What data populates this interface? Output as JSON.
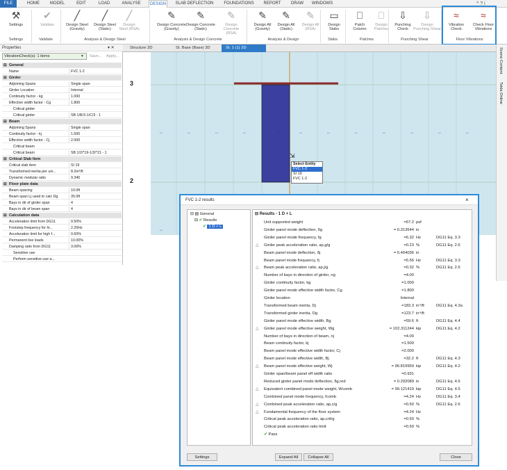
{
  "tabs": [
    "FILE",
    "HOME",
    "MODEL",
    "EDIT",
    "LOAD",
    "ANALYSE",
    "DESIGN",
    "SLAB DEFLECTION",
    "FOUNDATIONS",
    "REPORT",
    "DRAW",
    "WINDOWS"
  ],
  "window_icons": [
    "^",
    "?",
    "i"
  ],
  "ribbon": {
    "buttons": [
      "Settings",
      "Validate",
      "Design Steel (Gravity)",
      "Design Steel (Static)",
      "Design Steel (RSA)",
      "Design Concrete (Gravity)",
      "Design Concrete (Static)",
      "Design Concrete (RSA)",
      "Design All (Gravity)",
      "Design All (Static)",
      "Design All (RSA)",
      "Design Slabs",
      "Patch Column",
      "Design Patches",
      "Punching Check",
      "Design Punching Shear",
      "Vibration Check",
      "Check Floor Vibrations"
    ],
    "groups": [
      "Settings",
      "Validate",
      "Analysis & Design Steel",
      "Analysis & Design Concrete",
      "Analysis & Design",
      "Slabs",
      "Patches",
      "Punching Shear",
      "Floor Vibrations"
    ]
  },
  "properties": {
    "title": "Properties",
    "filter": "VibrationCheck(s): 1 items",
    "save": "Save...",
    "apply": "Apply...",
    "rows": [
      {
        "k": "General",
        "v": "",
        "h": true
      },
      {
        "k": "Name",
        "v": "FVC 1-2"
      },
      {
        "k": "Girder",
        "v": "",
        "h": true
      },
      {
        "k": "Adjoining Spans",
        "v": "Single span"
      },
      {
        "k": "Girder Location",
        "v": "Internal"
      },
      {
        "k": "Continuity factor - kg",
        "v": "1.000"
      },
      {
        "k": "Effective width factor - Cg",
        "v": "1.800"
      },
      {
        "k": "Critical girder",
        "v": "",
        "s": true
      },
      {
        "k": "Critical girder",
        "v": "SB 1/B/3-1/C/3 - 1",
        "s": true
      },
      {
        "k": "Beam",
        "v": "",
        "h": true
      },
      {
        "k": "Adjoining Spans",
        "v": "Single span"
      },
      {
        "k": "Continuity factor - kj",
        "v": "1.500"
      },
      {
        "k": "Effective width factor - Cj",
        "v": "2.000"
      },
      {
        "k": "Critical beam",
        "v": "",
        "s": true
      },
      {
        "k": "Critical beam",
        "v": "SB 1/2/*19-1/3/*21 - 1",
        "s": true
      },
      {
        "k": "Critical Slab Item",
        "v": "",
        "h": true
      },
      {
        "k": "Critical slab item",
        "v": "SI 19"
      },
      {
        "k": "Transformed inertia per uni...",
        "v": "8.2in³/ft"
      },
      {
        "k": "Dynamic modular ratio",
        "v": "9.340"
      },
      {
        "k": "Floor plate data",
        "v": "",
        "h": true
      },
      {
        "k": "Beam spacing",
        "v": "10.0ft"
      },
      {
        "k": "Beam span Lj used to calc Dg",
        "v": "35.0ft"
      },
      {
        "k": "Bays in dir of girder span",
        "v": "4"
      },
      {
        "k": "Bays in dir of beam span",
        "v": "4"
      },
      {
        "k": "Calculation data",
        "v": "",
        "h": true
      },
      {
        "k": "Acceleration limit from DG11",
        "v": "0.50%"
      },
      {
        "k": "Footstep frequency for hi...",
        "v": "2.20Hz"
      },
      {
        "k": "Acceleration limit for high f...",
        "v": "0.60%"
      },
      {
        "k": "Permanent live loads",
        "v": "10.00%"
      },
      {
        "k": "Damping ratio from DG11",
        "v": "3.00%"
      },
      {
        "k": "Sensitive use",
        "v": "",
        "s": true
      },
      {
        "k": "Perform sensitive use a...",
        "v": "",
        "s": true
      }
    ]
  },
  "view_tabs": [
    "Structure 3D",
    "St. Base (Base) 3D",
    "St. 1 (1) 2D"
  ],
  "side_tabs": [
    "Scene Content",
    "Tekla Online"
  ],
  "canvas": {
    "grid_labels": [
      "3",
      "2"
    ],
    "select_entity": {
      "title": "Select Entity",
      "items": [
        "FVC 1-2",
        "SI 19",
        "FVC 1-2"
      ]
    }
  },
  "dialog": {
    "title": "FVC 1-2 results",
    "close": "×",
    "tree": [
      "General",
      "Results",
      "1 D + L"
    ],
    "header": "Results - 1 D + L",
    "rows": [
      {
        "l": "Unit supported weight",
        "v": "=57.2",
        "u": "psf",
        "r": ""
      },
      {
        "l": "Girder panel mode deflection, δg",
        "v": "= 0.313644",
        "u": "in",
        "r": ""
      },
      {
        "l": "Girder panel mode frequency, fg",
        "v": "=6.32",
        "u": "Hz",
        "r": "DG11 Eq. 3.3"
      },
      {
        "l": "Girder peak acceleration ratio, ap,g/g",
        "v": "=0.23",
        "u": "%",
        "r": "DG11 Eq. 2.6",
        "w": true
      },
      {
        "l": "Beam panel mode deflection, δj",
        "v": "= 0.404036",
        "u": "in",
        "r": ""
      },
      {
        "l": "Beam panel mode frequency, fj",
        "v": "=5.56",
        "u": "Hz",
        "r": "DG11 Eq. 3.3"
      },
      {
        "l": "Beam peak acceleration ratio, ap,j/g",
        "v": "=0.32",
        "u": "%",
        "r": "DG11 Eq. 2.6",
        "w": true
      },
      {
        "l": "Number of bays in direction of girder, ng",
        "v": "=4.00",
        "u": "",
        "r": ""
      },
      {
        "l": "Girder continuity factor, kg",
        "v": "=1.000",
        "u": "",
        "r": ""
      },
      {
        "l": "Girder panel mode effective width factor, Cg",
        "v": "=1.800",
        "u": "",
        "r": ""
      },
      {
        "l": "Girder location",
        "v": "Internal",
        "u": "",
        "r": ""
      },
      {
        "l": "Transformed beam inertia, Dj",
        "v": "=183.3",
        "u": "in⁴/ft",
        "r": "DG11 Eq. 4.3a"
      },
      {
        "l": "Transformed girder inertia, Dg",
        "v": "=123.7",
        "u": "in⁴/ft",
        "r": ""
      },
      {
        "l": "Girder panel mode effective width, Bg",
        "v": "=59.6",
        "u": "ft",
        "r": "DG11 Eq. 4.4"
      },
      {
        "l": "Girder panel mode effective weight, Wg",
        "v": "= 102.311244",
        "u": "kip",
        "r": "DG11 Eq. 4.2",
        "w": true
      },
      {
        "l": "Number of bays in direction of beam, nj",
        "v": "=4.00",
        "u": "",
        "r": ""
      },
      {
        "l": "Beam continuity factor, kj",
        "v": "=1.500",
        "u": "",
        "r": ""
      },
      {
        "l": "Beam panel mode effective width factor, Cj",
        "v": "=2.000",
        "u": "",
        "r": ""
      },
      {
        "l": "Beam panel mode effective width, Bj",
        "v": "=32.2",
        "u": "ft",
        "r": "DG11 Eq. 4.3"
      },
      {
        "l": "Beam panel mode effective weight, Wj",
        "v": "= 96.819959",
        "u": "kip",
        "r": "DG11 Eq. 4.2",
        "w": true
      },
      {
        "l": "Girder span/beam panel eff width ratio",
        "v": "=0.931",
        "u": "",
        "r": ""
      },
      {
        "l": "Reduced girder panel mode deflection, δg,red",
        "v": "= 0.292089",
        "u": "in",
        "r": "DG11 Eq. 4.6"
      },
      {
        "l": "Equivalent combined panel mode weight, Wcomb",
        "v": "= 99.121419",
        "u": "kip",
        "r": "DG11 Eq. 4.5",
        "w": true
      },
      {
        "l": "Combined panel mode frequency, fcomb",
        "v": "=4.24",
        "u": "Hz",
        "r": "DG11 Eq. 3.4"
      },
      {
        "l": "Combined peak acceleration ratio, ap,c/g",
        "v": "=0.50",
        "u": "%",
        "r": "DG11 Eq. 2.6",
        "w": true
      },
      {
        "l": "Fundamental frequency of the floor system",
        "v": "=4.24",
        "u": "Hz",
        "r": "",
        "w": true
      },
      {
        "l": "Critical peak acceleration ratio, ap,crit/g",
        "v": "=0.50",
        "u": "%",
        "r": ""
      },
      {
        "l": "Critical peak acceleration ratio limit",
        "v": "=0.50",
        "u": "%",
        "r": ""
      },
      {
        "l": "Pass",
        "v": "",
        "u": "",
        "r": "",
        "p": true
      }
    ],
    "buttons": {
      "settings": "Settings",
      "expand": "Expand All",
      "collapse": "Collapse All",
      "close": "Close"
    }
  },
  "colors": {
    "accent": "#2e8ad8",
    "canvas": "#cfe6ef",
    "slab_item": "#3b3f9f",
    "pass": "#2f9a2f"
  }
}
